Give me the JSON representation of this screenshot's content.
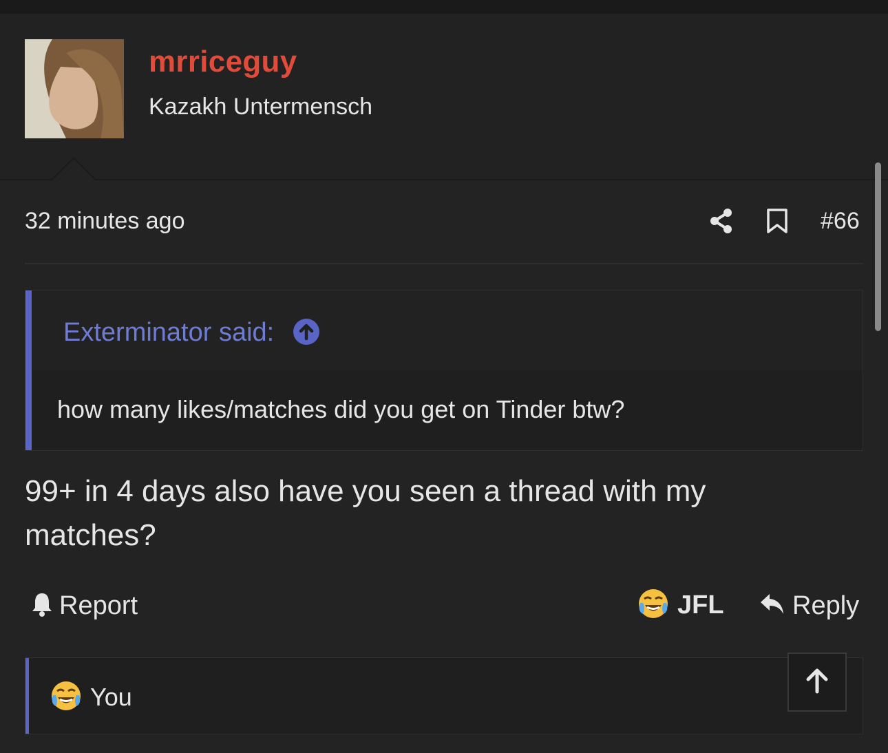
{
  "user": {
    "username": "mrriceguy",
    "title": "Kazakh Untermensch",
    "username_color": "#e04b3a"
  },
  "post": {
    "timestamp": "32 minutes ago",
    "number": "#66",
    "share_icon": "share-icon",
    "bookmark_icon": "bookmark-icon"
  },
  "quote": {
    "author": "Exterminator said:",
    "jump_icon": "arrow-up-circle-icon",
    "text": "how many likes/matches did you get on Tinder btw?"
  },
  "body": {
    "text": "99+ in 4 days also have you seen a thread with my matches?"
  },
  "actions": {
    "report": "Report",
    "reaction": "JFL",
    "reply": "Reply"
  },
  "reactions": {
    "users": "You",
    "emoji": "laughing-crying-emoji-icon"
  },
  "colors": {
    "accent": "#5865c7",
    "background": "#232323"
  }
}
